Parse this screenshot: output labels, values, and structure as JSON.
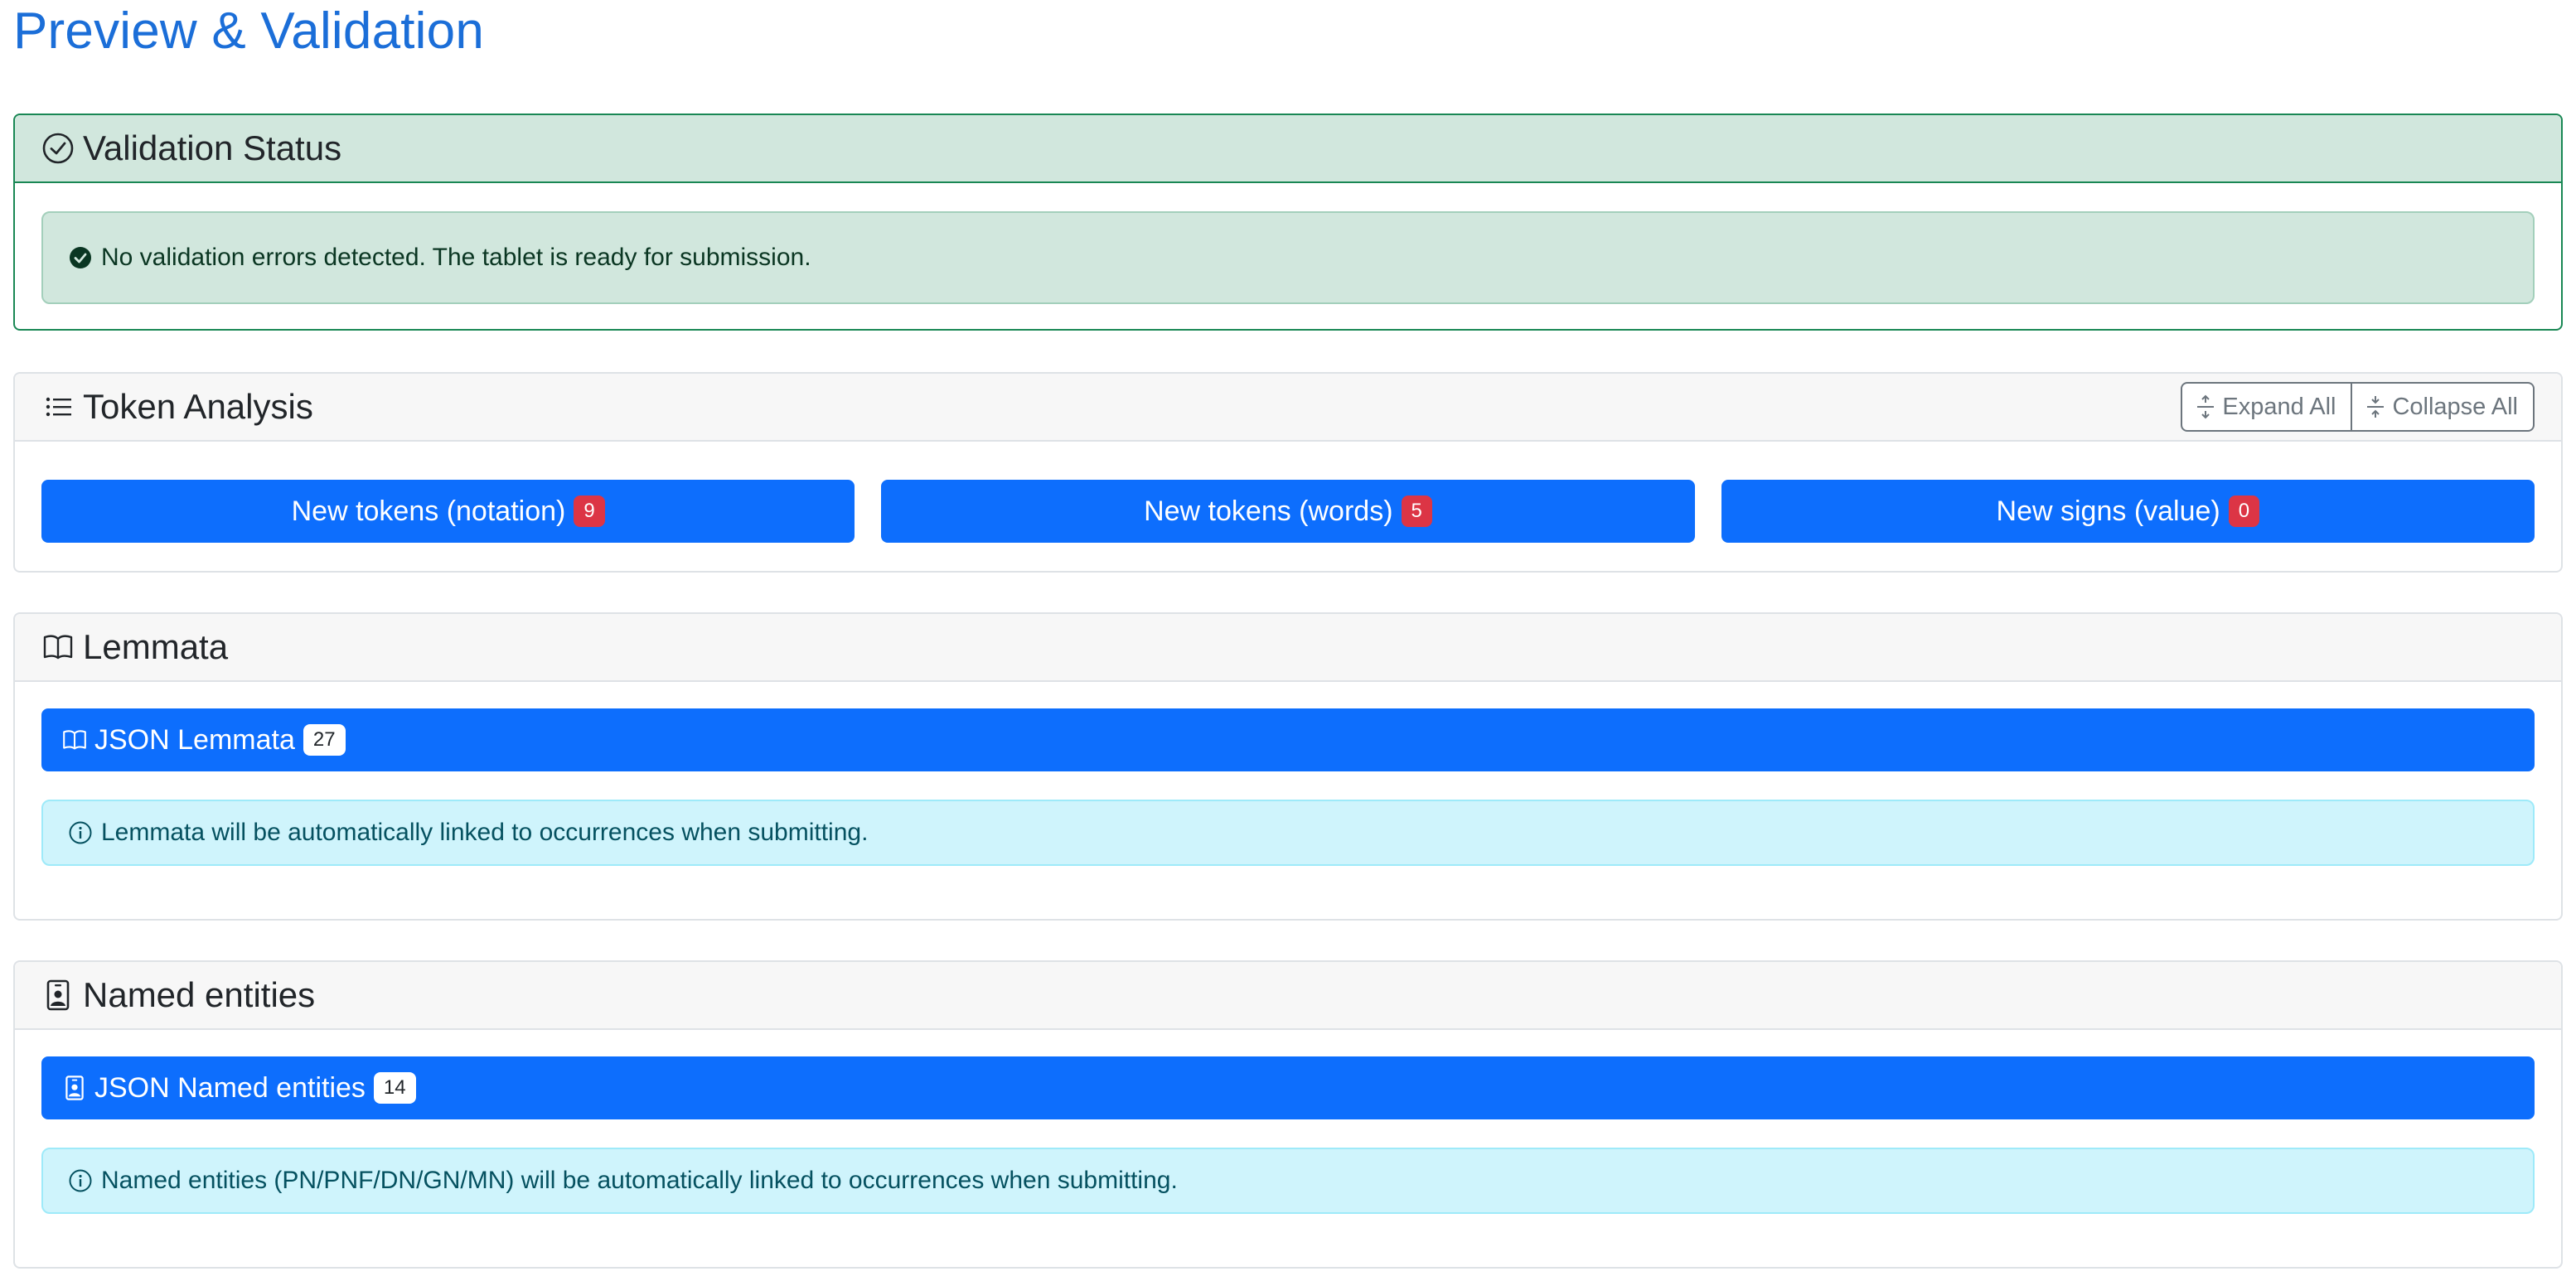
{
  "page": {
    "title": "Preview & Validation"
  },
  "validation": {
    "title": "Validation Status",
    "message": "No validation errors detected. The tablet is ready for submission."
  },
  "token_analysis": {
    "title": "Token Analysis",
    "expand_label": "Expand All",
    "collapse_label": "Collapse All",
    "buttons": [
      {
        "label": "New tokens (notation)",
        "count": "9"
      },
      {
        "label": "New tokens (words)",
        "count": "5"
      },
      {
        "label": "New signs (value)",
        "count": "0"
      }
    ]
  },
  "lemmata": {
    "title": "Lemmata",
    "json_label": "JSON Lemmata",
    "count": "27",
    "info": "Lemmata will be automatically linked to occurrences when submitting."
  },
  "named_entities": {
    "title": "Named entities",
    "json_label": "JSON Named entities",
    "count": "14",
    "info": "Named entities (PN/PNF/DN/GN/MN) will be automatically linked to occurrences when submitting."
  },
  "colors": {
    "title_blue": "#1b6ed8",
    "primary": "#0d6efd",
    "success_bg": "#d1e7dd",
    "success_border": "#198754",
    "info_bg": "#cff4fc",
    "badge_red": "#dc3545"
  },
  "icons": {
    "validation": "check-circle-icon",
    "success": "check-circle-fill-icon",
    "token": "list-icon",
    "expand": "expand-icon",
    "collapse": "collapse-icon",
    "lemmata": "book-icon",
    "info": "info-circle-icon",
    "entities": "person-badge-icon"
  }
}
